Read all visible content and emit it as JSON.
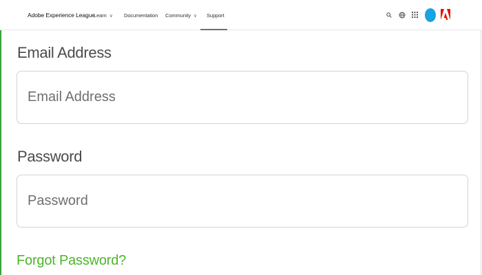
{
  "header": {
    "brand": "Adobe Experience League",
    "nav": [
      {
        "label": "Learn",
        "has_dropdown": true
      },
      {
        "label": "Documentation",
        "has_dropdown": false
      },
      {
        "label": "Community",
        "has_dropdown": true
      },
      {
        "label": "Support",
        "has_dropdown": false,
        "active": true
      }
    ],
    "icons": [
      "search-icon",
      "globe-icon",
      "apps-grid-icon",
      "avatar",
      "adobe-logo-icon"
    ],
    "chevron_glyph": "∨"
  },
  "form": {
    "email": {
      "label": "Email Address",
      "placeholder": "Email Address",
      "value": ""
    },
    "password": {
      "label": "Password",
      "placeholder": "Password",
      "value": ""
    },
    "forgot_password": "Forgot Password?"
  },
  "colors": {
    "link_green": "#4cb52a",
    "avatar_blue": "#17a4e0",
    "adobe_red": "#eb1000",
    "input_border": "#d2d2d2"
  }
}
